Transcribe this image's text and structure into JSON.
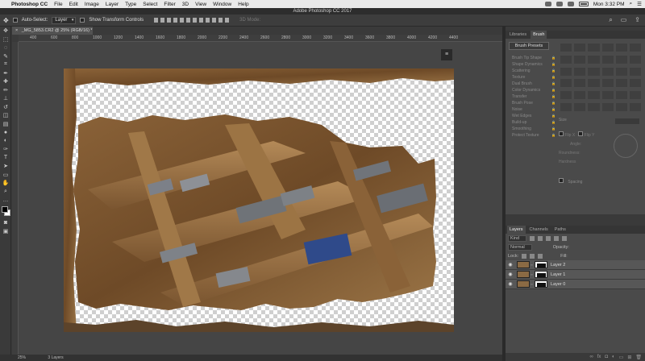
{
  "menubar": {
    "app_name": "Photoshop CC",
    "items": [
      "File",
      "Edit",
      "Image",
      "Layer",
      "Type",
      "Select",
      "Filter",
      "3D",
      "View",
      "Window",
      "Help"
    ],
    "clock": "Mon 3:32 PM"
  },
  "window_title": "Adobe Photoshop CC 2017",
  "options": {
    "auto_select_label": "Auto-Select:",
    "auto_select_value": "Layer",
    "show_transform_label": "Show Transform Controls",
    "mode_3d": "3D Mode:"
  },
  "document_tab": {
    "close": "×",
    "title": "_MG_5853.CR2 @ 25% (RGB/16) *"
  },
  "ruler_ticks": [
    "1000",
    "1200",
    "1400",
    "1600",
    "1800",
    "2000",
    "2200",
    "2400",
    "2600",
    "2800",
    "3000",
    "3200",
    "3400",
    "3600",
    "3800",
    "4000",
    "4200",
    "4400"
  ],
  "ruler_ticks_start": [
    "400",
    "600",
    "800"
  ],
  "status": {
    "zoom": "25%",
    "info": "3 Layers"
  },
  "brush_panel": {
    "tabs": [
      "Libraries",
      "Brush"
    ],
    "presets_button": "Brush Presets",
    "settings": [
      "Brush Tip Shape",
      "Shape Dynamics",
      "Scattering",
      "Texture",
      "Dual Brush",
      "Color Dynamics",
      "Transfer",
      "Brush Pose",
      "Noise",
      "Wet Edges",
      "Build-up",
      "Smoothing",
      "Protect Texture"
    ],
    "size_label": "Size",
    "flip_x": "Flip X",
    "flip_y": "Flip Y",
    "angle": "Angle:",
    "roundness": "Roundness:",
    "hardness": "Hardness",
    "spacing": "Spacing"
  },
  "layers_panel": {
    "tabs": [
      "Layers",
      "Channels",
      "Paths"
    ],
    "kind_label": "Kind",
    "blend_mode": "Normal",
    "opacity_label": "Opacity:",
    "lock_label": "Lock:",
    "fill_label": "Fill:",
    "layers": [
      {
        "name": "Layer 2"
      },
      {
        "name": "Layer 1"
      },
      {
        "name": "Layer 0"
      }
    ]
  }
}
